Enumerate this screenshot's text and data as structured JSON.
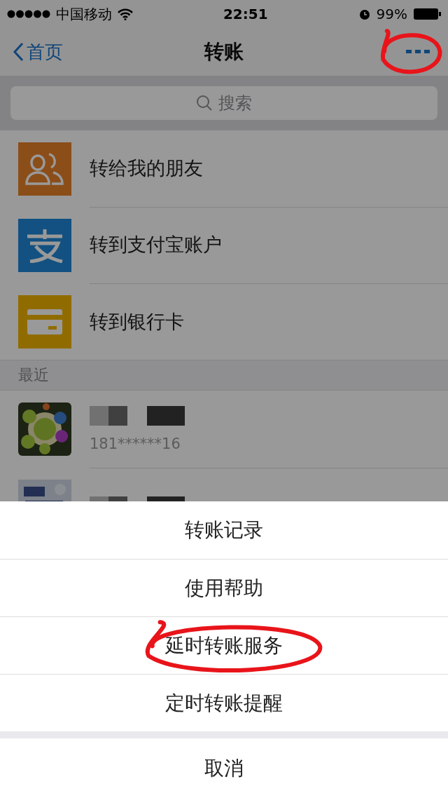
{
  "status_bar": {
    "carrier": "中国移动",
    "time": "22:51",
    "battery": "99%"
  },
  "nav": {
    "back": "首页",
    "title": "转账",
    "more_circled": true
  },
  "search": {
    "placeholder": "搜索"
  },
  "transfer_options": [
    {
      "label": "转给我的朋友",
      "kind": "friends"
    },
    {
      "label": "转到支付宝账户",
      "kind": "alipay"
    },
    {
      "label": "转到银行卡",
      "kind": "card"
    }
  ],
  "recent": {
    "header": "最近",
    "contacts": [
      {
        "name_redacted": true,
        "phone": "181******16"
      },
      {
        "name_redacted": true
      }
    ]
  },
  "action_sheet": {
    "items": [
      {
        "label": "转账记录",
        "circled": false
      },
      {
        "label": "使用帮助",
        "circled": false
      },
      {
        "label": "延时转账服务",
        "circled": true
      },
      {
        "label": "定时转账提醒",
        "circled": false
      }
    ],
    "cancel": "取消"
  }
}
